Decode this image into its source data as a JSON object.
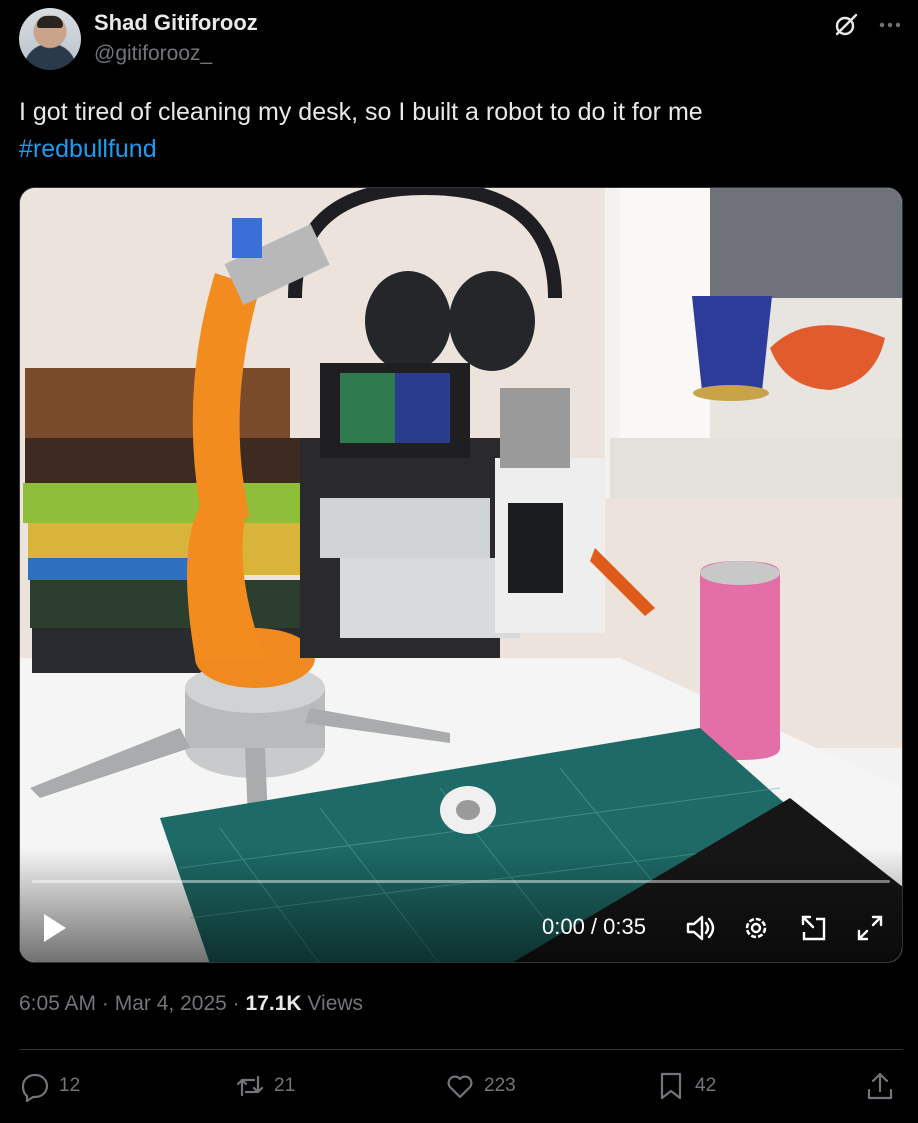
{
  "author": {
    "name": "Shad Gitiforooz",
    "handle": "@gitiforooz_"
  },
  "tweet": {
    "text": "I got tired of cleaning my desk, so I built a robot to do it for me",
    "hashtag": "#redbullfund"
  },
  "video": {
    "time": "0:00 / 0:35",
    "progress": 0
  },
  "meta": {
    "time": "6:05 AM",
    "sep1": "·",
    "date": "Mar 4, 2025",
    "sep2": "·",
    "views_count": "17.1K",
    "views_label": "Views"
  },
  "actions": {
    "replies": "12",
    "reposts": "21",
    "likes": "223",
    "bookmarks": "42"
  },
  "colors": {
    "background": "#000000",
    "text": "#e7e9ea",
    "muted": "#71767b",
    "accent": "#1d9bf0",
    "divider": "#2f3336"
  },
  "icons": [
    "grok-icon",
    "more-icon",
    "play-icon",
    "volume-icon",
    "settings-icon",
    "pip-icon",
    "fullscreen-icon",
    "reply-icon",
    "repost-icon",
    "like-icon",
    "bookmark-icon",
    "share-icon"
  ]
}
